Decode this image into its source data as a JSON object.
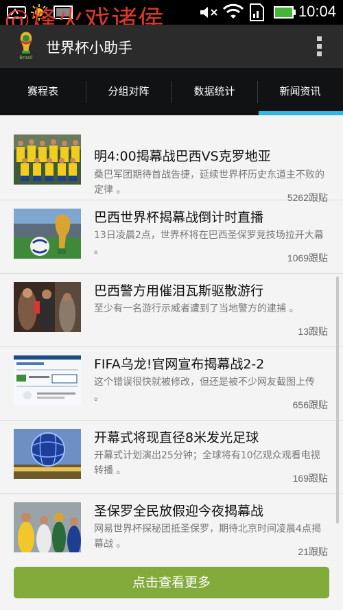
{
  "status_bar": {
    "watermark": "@烽火戏诸侯",
    "time": "10:04"
  },
  "app": {
    "title": "世界杯小助手",
    "icon": "world-cup-trophy-icon"
  },
  "tabs": [
    {
      "label": "赛程表",
      "active": false
    },
    {
      "label": "分组对阵",
      "active": false
    },
    {
      "label": "数据统计",
      "active": false
    },
    {
      "label": "新闻资讯",
      "active": true
    }
  ],
  "news": [
    {
      "title": "明4:00揭幕战巴西VS克罗地亚",
      "summary": "桑巴军团期待首战告捷，延续世界杯历史东道主不败的定律 。",
      "count": "5262跟贴",
      "thumb": "team-photo"
    },
    {
      "title": "巴西世界杯揭幕战倒计时直播",
      "summary": "13日凌晨2点，世界杯将在巴西圣保罗竞技场拉开大幕 。",
      "count": "1069跟贴",
      "thumb": "trophy-ball"
    },
    {
      "title": "巴西警方用催泪瓦斯驱散游行",
      "summary": "至少有一名游行示威者遭到了当地警方的逮捕 。",
      "count": "13跟贴",
      "thumb": "protest"
    },
    {
      "title": "FIFA乌龙!官网宣布揭幕战2-2",
      "summary": "这个错误很快就被修改，但还是被不少网友截图上传 。",
      "count": "656跟贴",
      "thumb": "website"
    },
    {
      "title": "开幕式将现直径8米发光足球",
      "summary": "开幕式计划演出25分钟；全球将有10亿观众观看电视转播 。",
      "count": "169跟贴",
      "thumb": "glowing-ball"
    },
    {
      "title": "圣保罗全民放假迎今夜揭幕战",
      "summary": "网易世界杯探秘团抵圣保罗，期待北京时间凌晨4点揭幕战 。",
      "count": "21跟贴",
      "thumb": "fans"
    }
  ],
  "more_button": "点击查看更多",
  "colors": {
    "tab_indicator": "#33b5e5",
    "more_button": "#82ab3b",
    "watermark": "#e33b2c"
  }
}
